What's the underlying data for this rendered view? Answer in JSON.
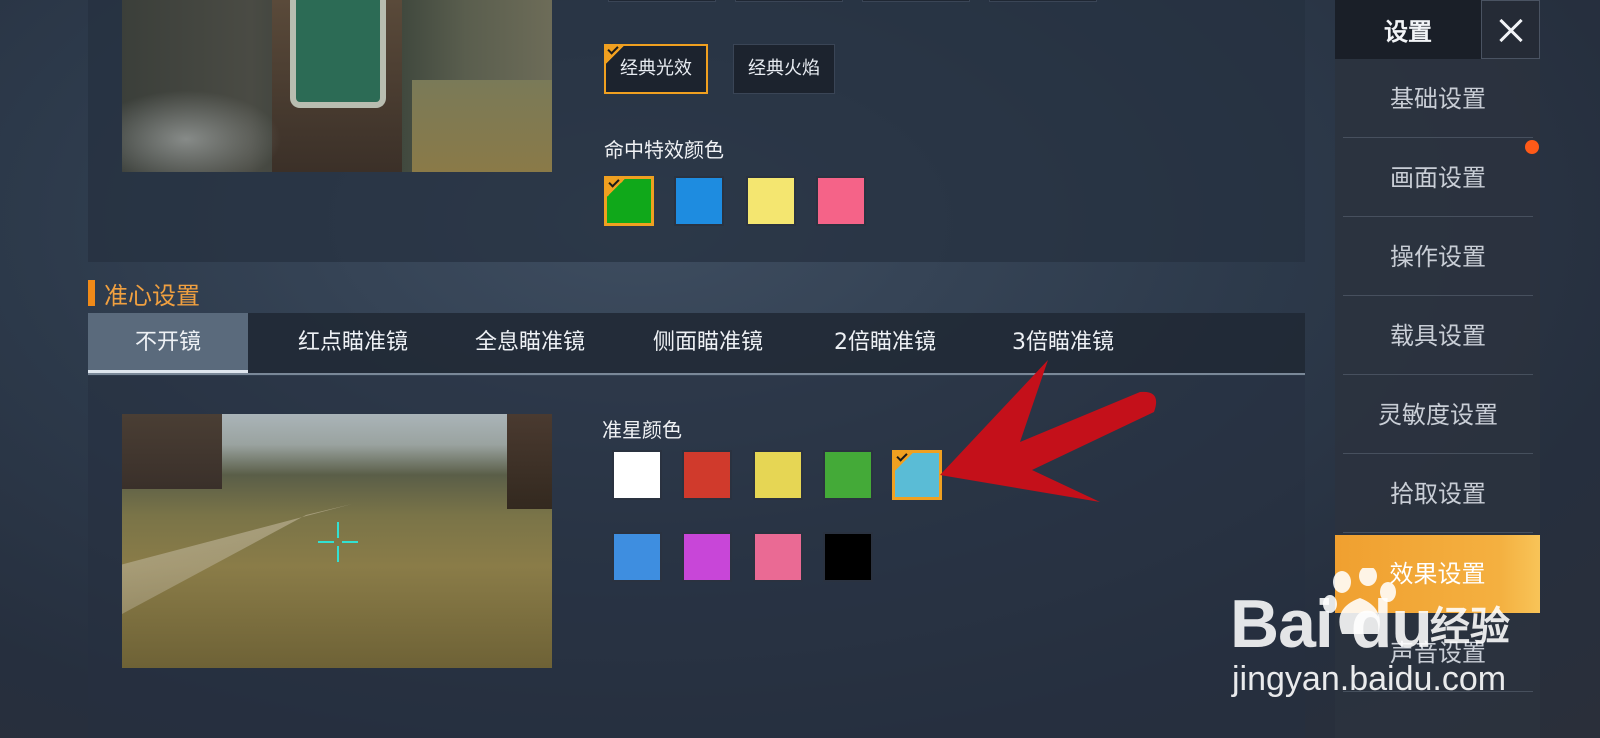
{
  "effects": {
    "styles": [
      {
        "label": "经典光效",
        "selected": true
      },
      {
        "label": "经典火焰",
        "selected": false
      }
    ],
    "hit_color_label": "命中特效颜色",
    "hit_colors": [
      "#10a81a",
      "#1e8ce0",
      "#f4e670",
      "#f56388"
    ],
    "hit_colors_selected_index": 0
  },
  "crosshair": {
    "section_title": "准心设置",
    "tabs": [
      "不开镜",
      "红点瞄准镜",
      "全息瞄准镜",
      "侧面瞄准镜",
      "2倍瞄准镜",
      "3倍瞄准镜"
    ],
    "active_tab_index": 0,
    "color_label": "准星颜色",
    "colors_row1": [
      "#ffffff",
      "#d03a2c",
      "#e6d654",
      "#44aa38",
      "#5abcd6"
    ],
    "colors_row2": [
      "#3e8ee0",
      "#c846d8",
      "#ea6a94",
      "#000000"
    ],
    "selected_color": "#5abcd6"
  },
  "sidebar": {
    "title": "设置",
    "items": [
      {
        "label": "基础设置"
      },
      {
        "label": "画面设置",
        "has_notification": true
      },
      {
        "label": "操作设置"
      },
      {
        "label": "载具设置"
      },
      {
        "label": "灵敏度设置"
      },
      {
        "label": "拾取设置"
      },
      {
        "label": "效果设置",
        "active": true
      },
      {
        "label": "声音设置"
      }
    ]
  },
  "watermark": {
    "logo": "Bai du",
    "text": "经验",
    "url": "jingyan.baidu.com"
  },
  "colors": {
    "accent": "#f0a020",
    "notification": "#ff5a18",
    "arrow": "#c4101a"
  }
}
